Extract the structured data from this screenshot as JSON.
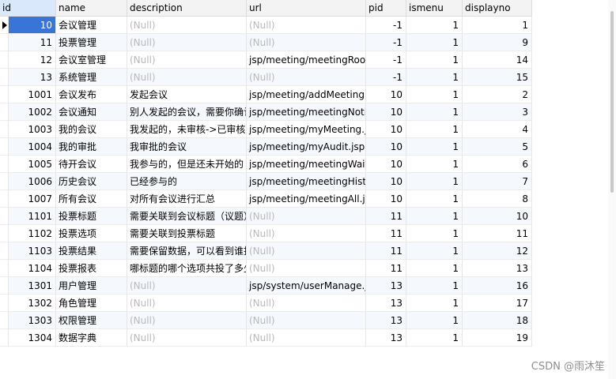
{
  "columns": [
    "id",
    "name",
    "description",
    "url",
    "pid",
    "ismenu",
    "displayno"
  ],
  "null_text": "(Null)",
  "rows": [
    {
      "id": "10",
      "name": "会议管理",
      "description": null,
      "url": null,
      "pid": "-1",
      "ismenu": "1",
      "displayno": "1"
    },
    {
      "id": "11",
      "name": "投票管理",
      "description": null,
      "url": null,
      "pid": "-1",
      "ismenu": "1",
      "displayno": "9"
    },
    {
      "id": "12",
      "name": "会议室管理",
      "description": null,
      "url": "jsp/meeting/meetingRoom",
      "pid": "-1",
      "ismenu": "1",
      "displayno": "14"
    },
    {
      "id": "13",
      "name": "系统管理",
      "description": null,
      "url": null,
      "pid": "-1",
      "ismenu": "1",
      "displayno": "15"
    },
    {
      "id": "1001",
      "name": "会议发布",
      "description": "发起会议",
      "url": "jsp/meeting/addMeeting.j",
      "pid": "10",
      "ismenu": "1",
      "displayno": "2"
    },
    {
      "id": "1002",
      "name": "会议通知",
      "description": "别人发起的会议，需要你确认",
      "url": "jsp/meeting/meetingNotif",
      "pid": "10",
      "ismenu": "1",
      "displayno": "3"
    },
    {
      "id": "1003",
      "name": "我的会议",
      "description": "我发起的，未审核->已审核",
      "url": "jsp/meeting/myMeeting.js",
      "pid": "10",
      "ismenu": "1",
      "displayno": "4"
    },
    {
      "id": "1004",
      "name": "我的审批",
      "description": "我审批的会议",
      "url": "jsp/meeting/myAudit.jsp",
      "pid": "10",
      "ismenu": "1",
      "displayno": "5"
    },
    {
      "id": "1005",
      "name": "待开会议",
      "description": "我参与的，但是还未开始的",
      "url": "jsp/meeting/meetingWait",
      "pid": "10",
      "ismenu": "1",
      "displayno": "6"
    },
    {
      "id": "1006",
      "name": "历史会议",
      "description": "已经参与的",
      "url": "jsp/meeting/meetingHisto",
      "pid": "10",
      "ismenu": "1",
      "displayno": "7"
    },
    {
      "id": "1007",
      "name": "所有会议",
      "description": "对所有会议进行汇总",
      "url": "jsp/meeting/meetingAll.js",
      "pid": "10",
      "ismenu": "1",
      "displayno": "8"
    },
    {
      "id": "1101",
      "name": "投票标题",
      "description": "需要关联到会议标题（议题）",
      "url": null,
      "pid": "11",
      "ismenu": "1",
      "displayno": "10"
    },
    {
      "id": "1102",
      "name": "投票选项",
      "description": "需要关联到投票标题",
      "url": null,
      "pid": "11",
      "ismenu": "1",
      "displayno": "11"
    },
    {
      "id": "1103",
      "name": "投票结果",
      "description": "需要保留数据，可以看到谁投",
      "url": null,
      "pid": "11",
      "ismenu": "1",
      "displayno": "12"
    },
    {
      "id": "1104",
      "name": "投票报表",
      "description": "哪标题的哪个选项共投了多少",
      "url": null,
      "pid": "11",
      "ismenu": "1",
      "displayno": "13"
    },
    {
      "id": "1301",
      "name": "用户管理",
      "description": null,
      "url": "jsp/system/userManage.js",
      "pid": "13",
      "ismenu": "1",
      "displayno": "16"
    },
    {
      "id": "1302",
      "name": "角色管理",
      "description": null,
      "url": null,
      "pid": "13",
      "ismenu": "1",
      "displayno": "17"
    },
    {
      "id": "1303",
      "name": "权限管理",
      "description": null,
      "url": null,
      "pid": "13",
      "ismenu": "1",
      "displayno": "18"
    },
    {
      "id": "1304",
      "name": "数据字典",
      "description": null,
      "url": null,
      "pid": "13",
      "ismenu": "1",
      "displayno": "19"
    }
  ],
  "selected_row": 0,
  "watermark": "CSDN @雨沐笙"
}
